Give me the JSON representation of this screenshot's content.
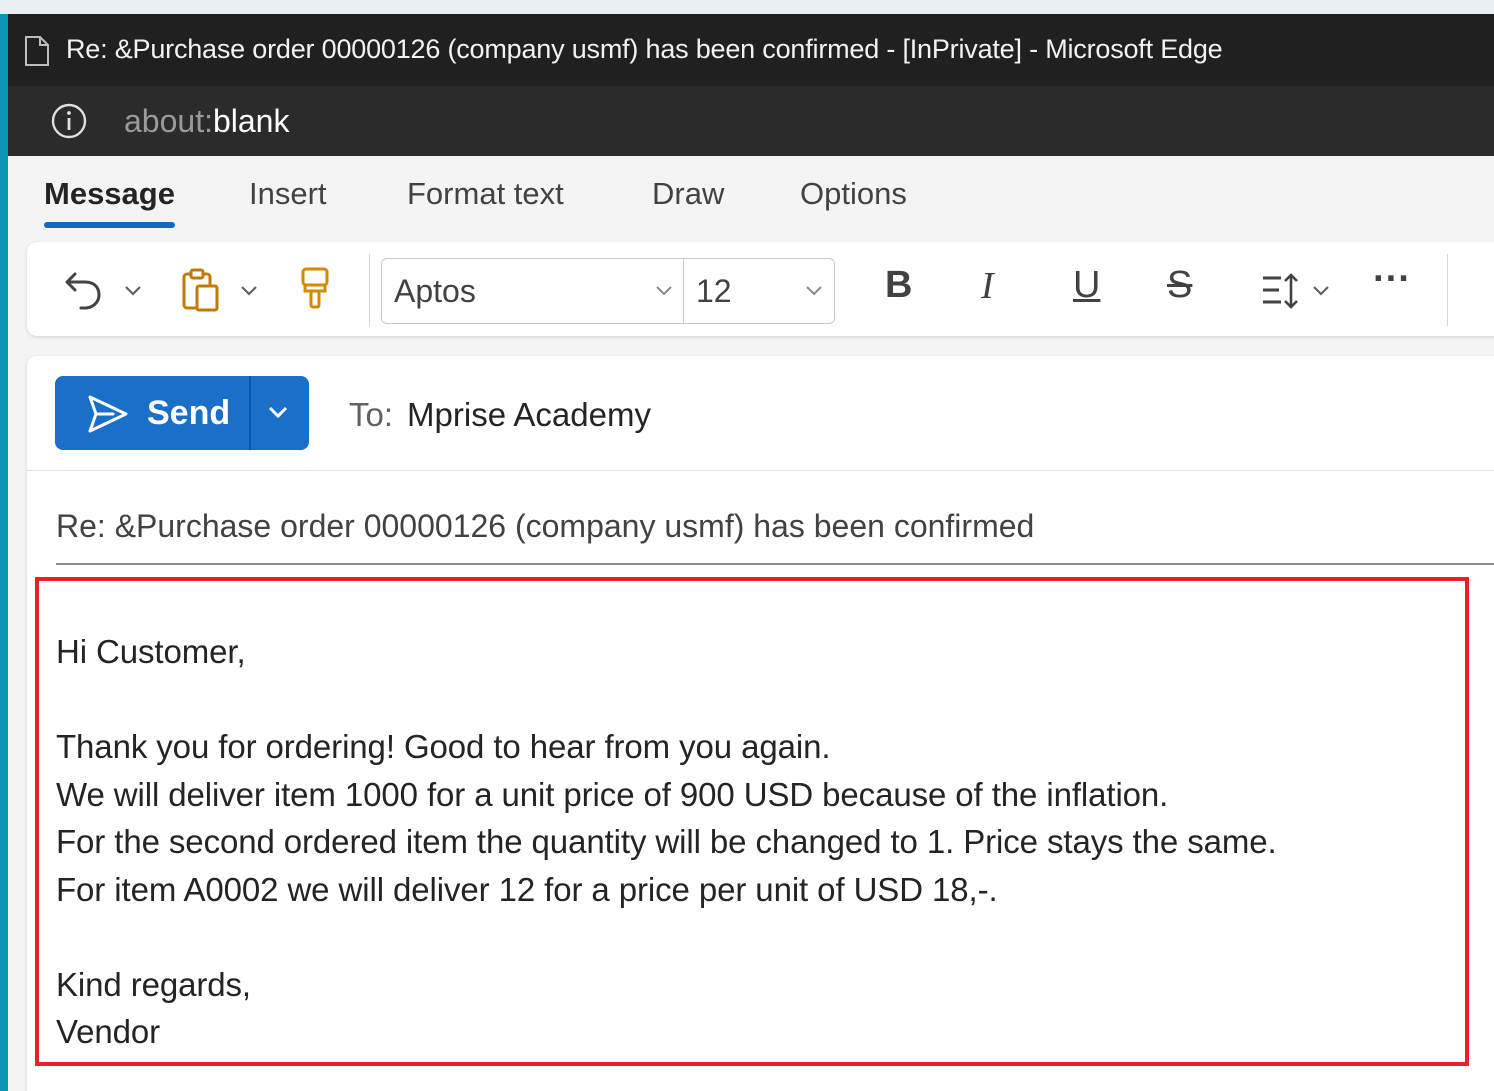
{
  "window": {
    "title": "Re: &Purchase order 00000126 (company usmf) has been confirmed - [InPrivate] - Microsoft Edge",
    "address": {
      "scheme": "about:",
      "path": "blank"
    }
  },
  "tabs": [
    {
      "label": "Message",
      "active": true
    },
    {
      "label": "Insert"
    },
    {
      "label": "Format text"
    },
    {
      "label": "Draw"
    },
    {
      "label": "Options"
    }
  ],
  "ribbon": {
    "font_name": "Aptos",
    "font_size": "12",
    "bold": "B",
    "italic": "I",
    "underline": "U",
    "strikethrough": "S",
    "more": "···"
  },
  "compose": {
    "send_label": "Send",
    "to_label": "To:",
    "to_value": "Mprise Academy",
    "subject": "Re: &Purchase order 00000126 (company usmf) has been confirmed",
    "body_lines": [
      "Hi Customer,",
      "",
      "Thank you for ordering! Good to hear from you again.",
      "We will deliver item 1000 for a unit price of 900 USD because of the inflation.",
      "For the second ordered item the quantity will be changed to 1. Price stays the same.",
      "For item A0002 we will deliver 12 for a price per unit of USD 18,-.",
      "",
      "Kind regards,",
      "Vendor"
    ]
  },
  "colors": {
    "accent": "#0f6cbd",
    "send_button": "#1a6fc9",
    "highlight_box": "#e8202a",
    "titlebar": "#202020"
  },
  "icons": [
    "page-icon",
    "info-icon",
    "undo-icon",
    "paste-icon",
    "format-painter-icon",
    "line-spacing-icon",
    "send-icon",
    "chevron-down-icon"
  ]
}
